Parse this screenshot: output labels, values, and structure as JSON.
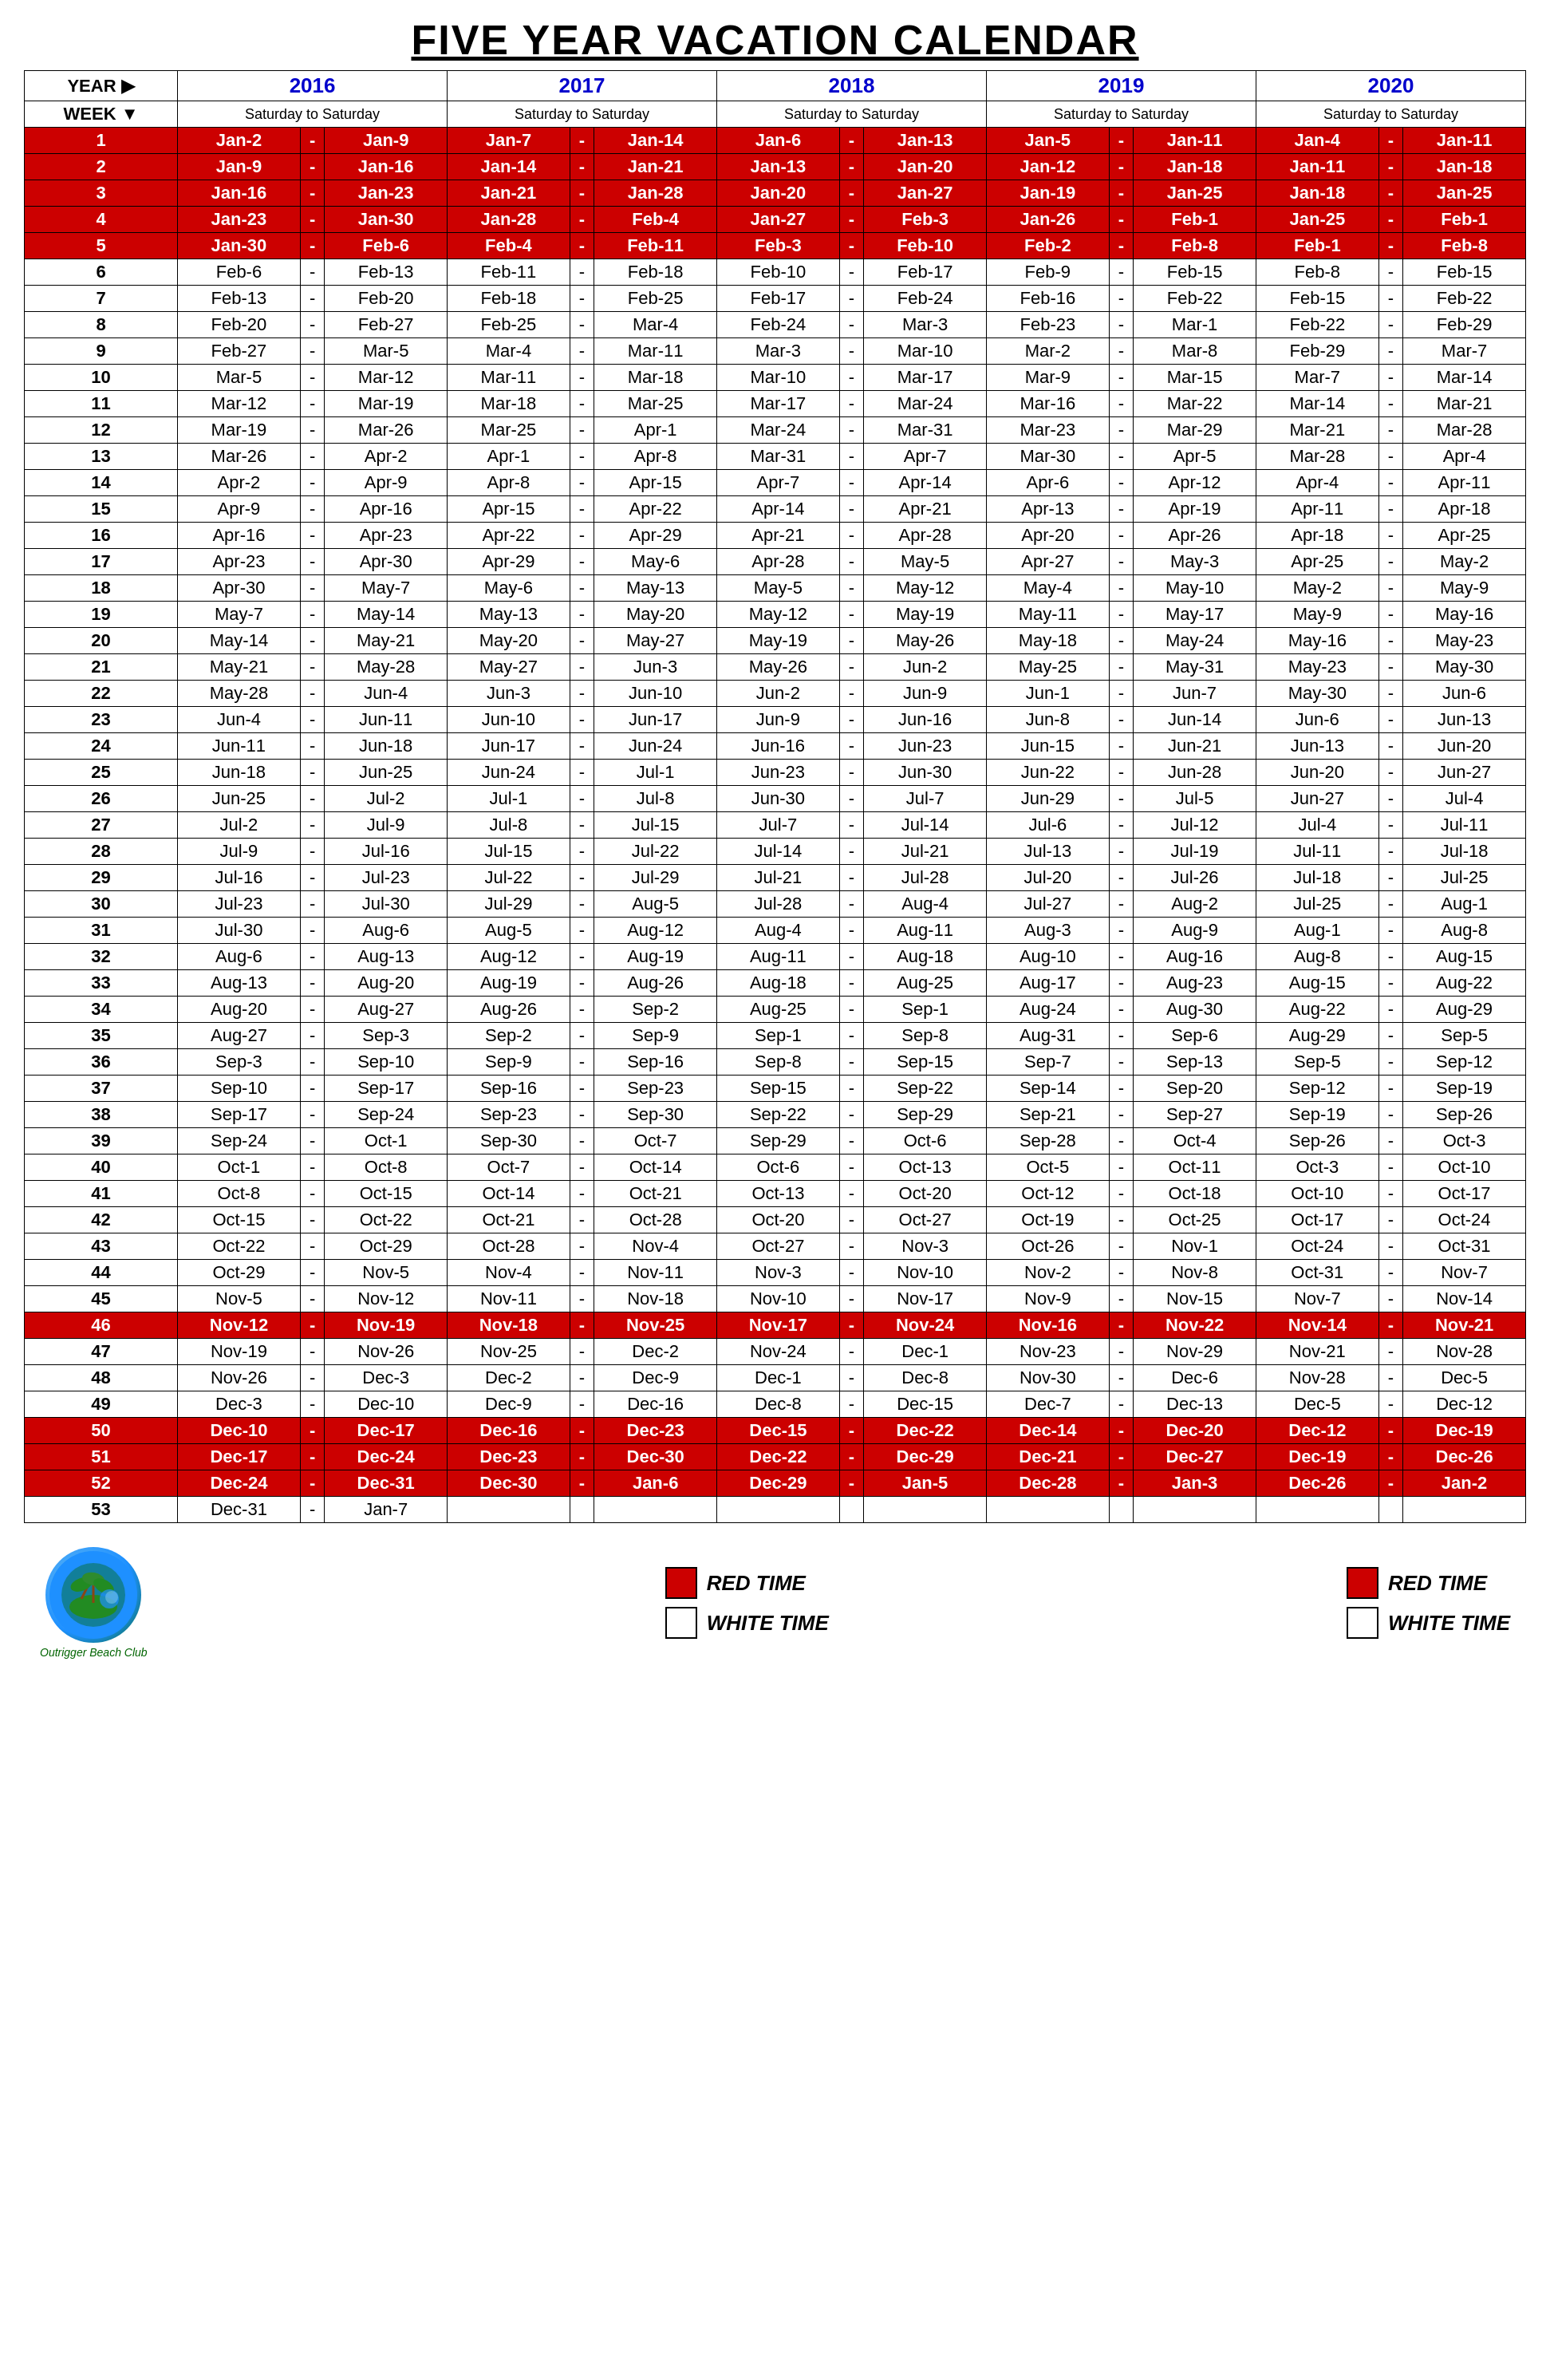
{
  "title": "FIVE YEAR VACATION CALENDAR",
  "years": [
    "2016",
    "2017",
    "2018",
    "2019",
    "2020"
  ],
  "year_label": "YEAR ▶",
  "week_label": "WEEK ▼",
  "sub_header": "Saturday to Saturday",
  "legend_center": {
    "red_label": "RED TIME",
    "white_label": "WHITE TIME"
  },
  "legend_right": {
    "red_label": "RED TIME",
    "white_label": "WHITE TIME"
  },
  "logo_text": "Outrigger Beach Club",
  "weeks": [
    {
      "num": "1",
      "red": true,
      "y2016": [
        "Jan-2",
        "Jan-9"
      ],
      "y2017": [
        "Jan-7",
        "Jan-14"
      ],
      "y2018": [
        "Jan-6",
        "Jan-13"
      ],
      "y2019": [
        "Jan-5",
        "Jan-11"
      ],
      "y2020": [
        "Jan-4",
        "Jan-11"
      ]
    },
    {
      "num": "2",
      "red": true,
      "y2016": [
        "Jan-9",
        "Jan-16"
      ],
      "y2017": [
        "Jan-14",
        "Jan-21"
      ],
      "y2018": [
        "Jan-13",
        "Jan-20"
      ],
      "y2019": [
        "Jan-12",
        "Jan-18"
      ],
      "y2020": [
        "Jan-11",
        "Jan-18"
      ]
    },
    {
      "num": "3",
      "red": true,
      "y2016": [
        "Jan-16",
        "Jan-23"
      ],
      "y2017": [
        "Jan-21",
        "Jan-28"
      ],
      "y2018": [
        "Jan-20",
        "Jan-27"
      ],
      "y2019": [
        "Jan-19",
        "Jan-25"
      ],
      "y2020": [
        "Jan-18",
        "Jan-25"
      ]
    },
    {
      "num": "4",
      "red": true,
      "y2016": [
        "Jan-23",
        "Jan-30"
      ],
      "y2017": [
        "Jan-28",
        "Feb-4"
      ],
      "y2018": [
        "Jan-27",
        "Feb-3"
      ],
      "y2019": [
        "Jan-26",
        "Feb-1"
      ],
      "y2020": [
        "Jan-25",
        "Feb-1"
      ]
    },
    {
      "num": "5",
      "red": true,
      "y2016": [
        "Jan-30",
        "Feb-6"
      ],
      "y2017": [
        "Feb-4",
        "Feb-11"
      ],
      "y2018": [
        "Feb-3",
        "Feb-10"
      ],
      "y2019": [
        "Feb-2",
        "Feb-8"
      ],
      "y2020": [
        "Feb-1",
        "Feb-8"
      ]
    },
    {
      "num": "6",
      "red": false,
      "y2016": [
        "Feb-6",
        "Feb-13"
      ],
      "y2017": [
        "Feb-11",
        "Feb-18"
      ],
      "y2018": [
        "Feb-10",
        "Feb-17"
      ],
      "y2019": [
        "Feb-9",
        "Feb-15"
      ],
      "y2020": [
        "Feb-8",
        "Feb-15"
      ]
    },
    {
      "num": "7",
      "red": false,
      "y2016": [
        "Feb-13",
        "Feb-20"
      ],
      "y2017": [
        "Feb-18",
        "Feb-25"
      ],
      "y2018": [
        "Feb-17",
        "Feb-24"
      ],
      "y2019": [
        "Feb-16",
        "Feb-22"
      ],
      "y2020": [
        "Feb-15",
        "Feb-22"
      ]
    },
    {
      "num": "8",
      "red": false,
      "y2016": [
        "Feb-20",
        "Feb-27"
      ],
      "y2017": [
        "Feb-25",
        "Mar-4"
      ],
      "y2018": [
        "Feb-24",
        "Mar-3"
      ],
      "y2019": [
        "Feb-23",
        "Mar-1"
      ],
      "y2020": [
        "Feb-22",
        "Feb-29"
      ]
    },
    {
      "num": "9",
      "red": false,
      "y2016": [
        "Feb-27",
        "Mar-5"
      ],
      "y2017": [
        "Mar-4",
        "Mar-11"
      ],
      "y2018": [
        "Mar-3",
        "Mar-10"
      ],
      "y2019": [
        "Mar-2",
        "Mar-8"
      ],
      "y2020": [
        "Feb-29",
        "Mar-7"
      ]
    },
    {
      "num": "10",
      "red": false,
      "y2016": [
        "Mar-5",
        "Mar-12"
      ],
      "y2017": [
        "Mar-11",
        "Mar-18"
      ],
      "y2018": [
        "Mar-10",
        "Mar-17"
      ],
      "y2019": [
        "Mar-9",
        "Mar-15"
      ],
      "y2020": [
        "Mar-7",
        "Mar-14"
      ]
    },
    {
      "num": "11",
      "red": false,
      "y2016": [
        "Mar-12",
        "Mar-19"
      ],
      "y2017": [
        "Mar-18",
        "Mar-25"
      ],
      "y2018": [
        "Mar-17",
        "Mar-24"
      ],
      "y2019": [
        "Mar-16",
        "Mar-22"
      ],
      "y2020": [
        "Mar-14",
        "Mar-21"
      ]
    },
    {
      "num": "12",
      "red": false,
      "y2016": [
        "Mar-19",
        "Mar-26"
      ],
      "y2017": [
        "Mar-25",
        "Apr-1"
      ],
      "y2018": [
        "Mar-24",
        "Mar-31"
      ],
      "y2019": [
        "Mar-23",
        "Mar-29"
      ],
      "y2020": [
        "Mar-21",
        "Mar-28"
      ]
    },
    {
      "num": "13",
      "red": false,
      "y2016": [
        "Mar-26",
        "Apr-2"
      ],
      "y2017": [
        "Apr-1",
        "Apr-8"
      ],
      "y2018": [
        "Mar-31",
        "Apr-7"
      ],
      "y2019": [
        "Mar-30",
        "Apr-5"
      ],
      "y2020": [
        "Mar-28",
        "Apr-4"
      ]
    },
    {
      "num": "14",
      "red": false,
      "y2016": [
        "Apr-2",
        "Apr-9"
      ],
      "y2017": [
        "Apr-8",
        "Apr-15"
      ],
      "y2018": [
        "Apr-7",
        "Apr-14"
      ],
      "y2019": [
        "Apr-6",
        "Apr-12"
      ],
      "y2020": [
        "Apr-4",
        "Apr-11"
      ]
    },
    {
      "num": "15",
      "red": false,
      "y2016": [
        "Apr-9",
        "Apr-16"
      ],
      "y2017": [
        "Apr-15",
        "Apr-22"
      ],
      "y2018": [
        "Apr-14",
        "Apr-21"
      ],
      "y2019": [
        "Apr-13",
        "Apr-19"
      ],
      "y2020": [
        "Apr-11",
        "Apr-18"
      ]
    },
    {
      "num": "16",
      "red": false,
      "y2016": [
        "Apr-16",
        "Apr-23"
      ],
      "y2017": [
        "Apr-22",
        "Apr-29"
      ],
      "y2018": [
        "Apr-21",
        "Apr-28"
      ],
      "y2019": [
        "Apr-20",
        "Apr-26"
      ],
      "y2020": [
        "Apr-18",
        "Apr-25"
      ]
    },
    {
      "num": "17",
      "red": false,
      "y2016": [
        "Apr-23",
        "Apr-30"
      ],
      "y2017": [
        "Apr-29",
        "May-6"
      ],
      "y2018": [
        "Apr-28",
        "May-5"
      ],
      "y2019": [
        "Apr-27",
        "May-3"
      ],
      "y2020": [
        "Apr-25",
        "May-2"
      ]
    },
    {
      "num": "18",
      "red": false,
      "y2016": [
        "Apr-30",
        "May-7"
      ],
      "y2017": [
        "May-6",
        "May-13"
      ],
      "y2018": [
        "May-5",
        "May-12"
      ],
      "y2019": [
        "May-4",
        "May-10"
      ],
      "y2020": [
        "May-2",
        "May-9"
      ]
    },
    {
      "num": "19",
      "red": false,
      "y2016": [
        "May-7",
        "May-14"
      ],
      "y2017": [
        "May-13",
        "May-20"
      ],
      "y2018": [
        "May-12",
        "May-19"
      ],
      "y2019": [
        "May-11",
        "May-17"
      ],
      "y2020": [
        "May-9",
        "May-16"
      ]
    },
    {
      "num": "20",
      "red": false,
      "y2016": [
        "May-14",
        "May-21"
      ],
      "y2017": [
        "May-20",
        "May-27"
      ],
      "y2018": [
        "May-19",
        "May-26"
      ],
      "y2019": [
        "May-18",
        "May-24"
      ],
      "y2020": [
        "May-16",
        "May-23"
      ]
    },
    {
      "num": "21",
      "red": false,
      "y2016": [
        "May-21",
        "May-28"
      ],
      "y2017": [
        "May-27",
        "Jun-3"
      ],
      "y2018": [
        "May-26",
        "Jun-2"
      ],
      "y2019": [
        "May-25",
        "May-31"
      ],
      "y2020": [
        "May-23",
        "May-30"
      ]
    },
    {
      "num": "22",
      "red": false,
      "y2016": [
        "May-28",
        "Jun-4"
      ],
      "y2017": [
        "Jun-3",
        "Jun-10"
      ],
      "y2018": [
        "Jun-2",
        "Jun-9"
      ],
      "y2019": [
        "Jun-1",
        "Jun-7"
      ],
      "y2020": [
        "May-30",
        "Jun-6"
      ]
    },
    {
      "num": "23",
      "red": false,
      "y2016": [
        "Jun-4",
        "Jun-11"
      ],
      "y2017": [
        "Jun-10",
        "Jun-17"
      ],
      "y2018": [
        "Jun-9",
        "Jun-16"
      ],
      "y2019": [
        "Jun-8",
        "Jun-14"
      ],
      "y2020": [
        "Jun-6",
        "Jun-13"
      ]
    },
    {
      "num": "24",
      "red": false,
      "y2016": [
        "Jun-11",
        "Jun-18"
      ],
      "y2017": [
        "Jun-17",
        "Jun-24"
      ],
      "y2018": [
        "Jun-16",
        "Jun-23"
      ],
      "y2019": [
        "Jun-15",
        "Jun-21"
      ],
      "y2020": [
        "Jun-13",
        "Jun-20"
      ]
    },
    {
      "num": "25",
      "red": false,
      "y2016": [
        "Jun-18",
        "Jun-25"
      ],
      "y2017": [
        "Jun-24",
        "Jul-1"
      ],
      "y2018": [
        "Jun-23",
        "Jun-30"
      ],
      "y2019": [
        "Jun-22",
        "Jun-28"
      ],
      "y2020": [
        "Jun-20",
        "Jun-27"
      ]
    },
    {
      "num": "26",
      "red": false,
      "y2016": [
        "Jun-25",
        "Jul-2"
      ],
      "y2017": [
        "Jul-1",
        "Jul-8"
      ],
      "y2018": [
        "Jun-30",
        "Jul-7"
      ],
      "y2019": [
        "Jun-29",
        "Jul-5"
      ],
      "y2020": [
        "Jun-27",
        "Jul-4"
      ]
    },
    {
      "num": "27",
      "red": false,
      "y2016": [
        "Jul-2",
        "Jul-9"
      ],
      "y2017": [
        "Jul-8",
        "Jul-15"
      ],
      "y2018": [
        "Jul-7",
        "Jul-14"
      ],
      "y2019": [
        "Jul-6",
        "Jul-12"
      ],
      "y2020": [
        "Jul-4",
        "Jul-11"
      ]
    },
    {
      "num": "28",
      "red": false,
      "y2016": [
        "Jul-9",
        "Jul-16"
      ],
      "y2017": [
        "Jul-15",
        "Jul-22"
      ],
      "y2018": [
        "Jul-14",
        "Jul-21"
      ],
      "y2019": [
        "Jul-13",
        "Jul-19"
      ],
      "y2020": [
        "Jul-11",
        "Jul-18"
      ]
    },
    {
      "num": "29",
      "red": false,
      "y2016": [
        "Jul-16",
        "Jul-23"
      ],
      "y2017": [
        "Jul-22",
        "Jul-29"
      ],
      "y2018": [
        "Jul-21",
        "Jul-28"
      ],
      "y2019": [
        "Jul-20",
        "Jul-26"
      ],
      "y2020": [
        "Jul-18",
        "Jul-25"
      ]
    },
    {
      "num": "30",
      "red": false,
      "y2016": [
        "Jul-23",
        "Jul-30"
      ],
      "y2017": [
        "Jul-29",
        "Aug-5"
      ],
      "y2018": [
        "Jul-28",
        "Aug-4"
      ],
      "y2019": [
        "Jul-27",
        "Aug-2"
      ],
      "y2020": [
        "Jul-25",
        "Aug-1"
      ]
    },
    {
      "num": "31",
      "red": false,
      "y2016": [
        "Jul-30",
        "Aug-6"
      ],
      "y2017": [
        "Aug-5",
        "Aug-12"
      ],
      "y2018": [
        "Aug-4",
        "Aug-11"
      ],
      "y2019": [
        "Aug-3",
        "Aug-9"
      ],
      "y2020": [
        "Aug-1",
        "Aug-8"
      ]
    },
    {
      "num": "32",
      "red": false,
      "y2016": [
        "Aug-6",
        "Aug-13"
      ],
      "y2017": [
        "Aug-12",
        "Aug-19"
      ],
      "y2018": [
        "Aug-11",
        "Aug-18"
      ],
      "y2019": [
        "Aug-10",
        "Aug-16"
      ],
      "y2020": [
        "Aug-8",
        "Aug-15"
      ]
    },
    {
      "num": "33",
      "red": false,
      "y2016": [
        "Aug-13",
        "Aug-20"
      ],
      "y2017": [
        "Aug-19",
        "Aug-26"
      ],
      "y2018": [
        "Aug-18",
        "Aug-25"
      ],
      "y2019": [
        "Aug-17",
        "Aug-23"
      ],
      "y2020": [
        "Aug-15",
        "Aug-22"
      ]
    },
    {
      "num": "34",
      "red": false,
      "y2016": [
        "Aug-20",
        "Aug-27"
      ],
      "y2017": [
        "Aug-26",
        "Sep-2"
      ],
      "y2018": [
        "Aug-25",
        "Sep-1"
      ],
      "y2019": [
        "Aug-24",
        "Aug-30"
      ],
      "y2020": [
        "Aug-22",
        "Aug-29"
      ]
    },
    {
      "num": "35",
      "red": false,
      "y2016": [
        "Aug-27",
        "Sep-3"
      ],
      "y2017": [
        "Sep-2",
        "Sep-9"
      ],
      "y2018": [
        "Sep-1",
        "Sep-8"
      ],
      "y2019": [
        "Aug-31",
        "Sep-6"
      ],
      "y2020": [
        "Aug-29",
        "Sep-5"
      ]
    },
    {
      "num": "36",
      "red": false,
      "y2016": [
        "Sep-3",
        "Sep-10"
      ],
      "y2017": [
        "Sep-9",
        "Sep-16"
      ],
      "y2018": [
        "Sep-8",
        "Sep-15"
      ],
      "y2019": [
        "Sep-7",
        "Sep-13"
      ],
      "y2020": [
        "Sep-5",
        "Sep-12"
      ]
    },
    {
      "num": "37",
      "red": false,
      "y2016": [
        "Sep-10",
        "Sep-17"
      ],
      "y2017": [
        "Sep-16",
        "Sep-23"
      ],
      "y2018": [
        "Sep-15",
        "Sep-22"
      ],
      "y2019": [
        "Sep-14",
        "Sep-20"
      ],
      "y2020": [
        "Sep-12",
        "Sep-19"
      ]
    },
    {
      "num": "38",
      "red": false,
      "y2016": [
        "Sep-17",
        "Sep-24"
      ],
      "y2017": [
        "Sep-23",
        "Sep-30"
      ],
      "y2018": [
        "Sep-22",
        "Sep-29"
      ],
      "y2019": [
        "Sep-21",
        "Sep-27"
      ],
      "y2020": [
        "Sep-19",
        "Sep-26"
      ]
    },
    {
      "num": "39",
      "red": false,
      "y2016": [
        "Sep-24",
        "Oct-1"
      ],
      "y2017": [
        "Sep-30",
        "Oct-7"
      ],
      "y2018": [
        "Sep-29",
        "Oct-6"
      ],
      "y2019": [
        "Sep-28",
        "Oct-4"
      ],
      "y2020": [
        "Sep-26",
        "Oct-3"
      ]
    },
    {
      "num": "40",
      "red": false,
      "y2016": [
        "Oct-1",
        "Oct-8"
      ],
      "y2017": [
        "Oct-7",
        "Oct-14"
      ],
      "y2018": [
        "Oct-6",
        "Oct-13"
      ],
      "y2019": [
        "Oct-5",
        "Oct-11"
      ],
      "y2020": [
        "Oct-3",
        "Oct-10"
      ]
    },
    {
      "num": "41",
      "red": false,
      "y2016": [
        "Oct-8",
        "Oct-15"
      ],
      "y2017": [
        "Oct-14",
        "Oct-21"
      ],
      "y2018": [
        "Oct-13",
        "Oct-20"
      ],
      "y2019": [
        "Oct-12",
        "Oct-18"
      ],
      "y2020": [
        "Oct-10",
        "Oct-17"
      ]
    },
    {
      "num": "42",
      "red": false,
      "y2016": [
        "Oct-15",
        "Oct-22"
      ],
      "y2017": [
        "Oct-21",
        "Oct-28"
      ],
      "y2018": [
        "Oct-20",
        "Oct-27"
      ],
      "y2019": [
        "Oct-19",
        "Oct-25"
      ],
      "y2020": [
        "Oct-17",
        "Oct-24"
      ]
    },
    {
      "num": "43",
      "red": false,
      "y2016": [
        "Oct-22",
        "Oct-29"
      ],
      "y2017": [
        "Oct-28",
        "Nov-4"
      ],
      "y2018": [
        "Oct-27",
        "Nov-3"
      ],
      "y2019": [
        "Oct-26",
        "Nov-1"
      ],
      "y2020": [
        "Oct-24",
        "Oct-31"
      ]
    },
    {
      "num": "44",
      "red": false,
      "y2016": [
        "Oct-29",
        "Nov-5"
      ],
      "y2017": [
        "Nov-4",
        "Nov-11"
      ],
      "y2018": [
        "Nov-3",
        "Nov-10"
      ],
      "y2019": [
        "Nov-2",
        "Nov-8"
      ],
      "y2020": [
        "Oct-31",
        "Nov-7"
      ]
    },
    {
      "num": "45",
      "red": false,
      "y2016": [
        "Nov-5",
        "Nov-12"
      ],
      "y2017": [
        "Nov-11",
        "Nov-18"
      ],
      "y2018": [
        "Nov-10",
        "Nov-17"
      ],
      "y2019": [
        "Nov-9",
        "Nov-15"
      ],
      "y2020": [
        "Nov-7",
        "Nov-14"
      ]
    },
    {
      "num": "46",
      "red": true,
      "y2016": [
        "Nov-12",
        "Nov-19"
      ],
      "y2017": [
        "Nov-18",
        "Nov-25"
      ],
      "y2018": [
        "Nov-17",
        "Nov-24"
      ],
      "y2019": [
        "Nov-16",
        "Nov-22"
      ],
      "y2020": [
        "Nov-14",
        "Nov-21"
      ]
    },
    {
      "num": "47",
      "red": false,
      "y2016": [
        "Nov-19",
        "Nov-26"
      ],
      "y2017": [
        "Nov-25",
        "Dec-2"
      ],
      "y2018": [
        "Nov-24",
        "Dec-1"
      ],
      "y2019": [
        "Nov-23",
        "Nov-29"
      ],
      "y2020": [
        "Nov-21",
        "Nov-28"
      ]
    },
    {
      "num": "48",
      "red": false,
      "y2016": [
        "Nov-26",
        "Dec-3"
      ],
      "y2017": [
        "Dec-2",
        "Dec-9"
      ],
      "y2018": [
        "Dec-1",
        "Dec-8"
      ],
      "y2019": [
        "Nov-30",
        "Dec-6"
      ],
      "y2020": [
        "Nov-28",
        "Dec-5"
      ]
    },
    {
      "num": "49",
      "red": false,
      "y2016": [
        "Dec-3",
        "Dec-10"
      ],
      "y2017": [
        "Dec-9",
        "Dec-16"
      ],
      "y2018": [
        "Dec-8",
        "Dec-15"
      ],
      "y2019": [
        "Dec-7",
        "Dec-13"
      ],
      "y2020": [
        "Dec-5",
        "Dec-12"
      ]
    },
    {
      "num": "50",
      "red": true,
      "y2016": [
        "Dec-10",
        "Dec-17"
      ],
      "y2017": [
        "Dec-16",
        "Dec-23"
      ],
      "y2018": [
        "Dec-15",
        "Dec-22"
      ],
      "y2019": [
        "Dec-14",
        "Dec-20"
      ],
      "y2020": [
        "Dec-12",
        "Dec-19"
      ]
    },
    {
      "num": "51",
      "red": true,
      "y2016": [
        "Dec-17",
        "Dec-24"
      ],
      "y2017": [
        "Dec-23",
        "Dec-30"
      ],
      "y2018": [
        "Dec-22",
        "Dec-29"
      ],
      "y2019": [
        "Dec-21",
        "Dec-27"
      ],
      "y2020": [
        "Dec-19",
        "Dec-26"
      ]
    },
    {
      "num": "52",
      "red": true,
      "y2016": [
        "Dec-24",
        "Dec-31"
      ],
      "y2017": [
        "Dec-30",
        "Jan-6"
      ],
      "y2018": [
        "Dec-29",
        "Jan-5"
      ],
      "y2019": [
        "Dec-28",
        "Jan-3"
      ],
      "y2020": [
        "Dec-26",
        "Jan-2"
      ]
    },
    {
      "num": "53",
      "red": false,
      "y2016": [
        "Dec-31",
        "Jan-7"
      ],
      "y2017": [
        "",
        ""
      ],
      "y2018": [
        "",
        ""
      ],
      "y2019": [
        "",
        ""
      ],
      "y2020": [
        "",
        ""
      ]
    }
  ]
}
